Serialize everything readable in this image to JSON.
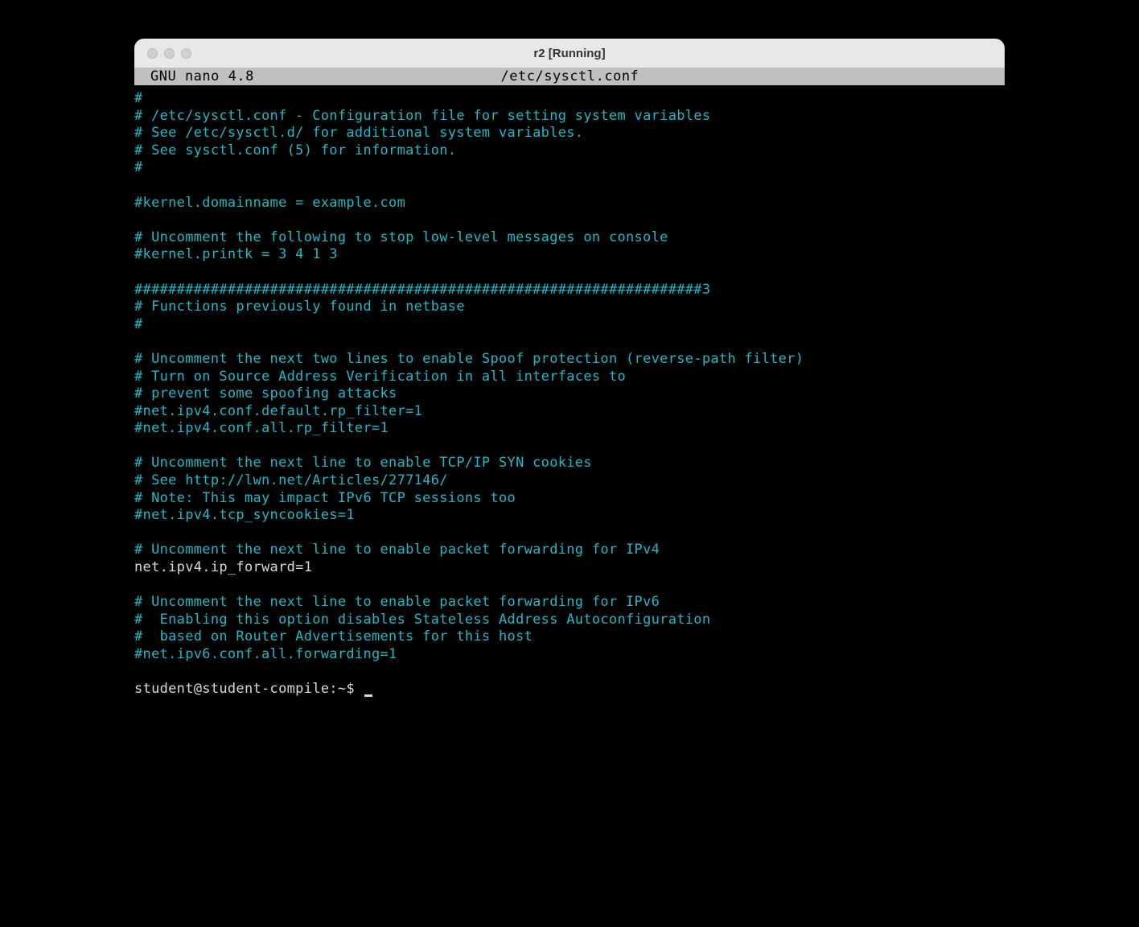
{
  "window": {
    "title": "r2 [Running]"
  },
  "nano": {
    "app": "  GNU nano 4.8",
    "file": "/etc/sysctl.conf"
  },
  "lines": [
    {
      "text": "#",
      "cls": "comment"
    },
    {
      "text": "# /etc/sysctl.conf - Configuration file for setting system variables",
      "cls": "comment"
    },
    {
      "text": "# See /etc/sysctl.d/ for additional system variables.",
      "cls": "comment"
    },
    {
      "text": "# See sysctl.conf (5) for information.",
      "cls": "comment"
    },
    {
      "text": "#",
      "cls": "comment"
    },
    {
      "text": "",
      "cls": "comment"
    },
    {
      "text": "#kernel.domainname = example.com",
      "cls": "comment"
    },
    {
      "text": "",
      "cls": "comment"
    },
    {
      "text": "# Uncomment the following to stop low-level messages on console",
      "cls": "comment"
    },
    {
      "text": "#kernel.printk = 3 4 1 3",
      "cls": "comment"
    },
    {
      "text": "",
      "cls": "comment"
    },
    {
      "text": "###################################################################3",
      "cls": "comment"
    },
    {
      "text": "# Functions previously found in netbase",
      "cls": "comment"
    },
    {
      "text": "#",
      "cls": "comment"
    },
    {
      "text": "",
      "cls": "comment"
    },
    {
      "text": "# Uncomment the next two lines to enable Spoof protection (reverse-path filter)",
      "cls": "comment"
    },
    {
      "text": "# Turn on Source Address Verification in all interfaces to",
      "cls": "comment"
    },
    {
      "text": "# prevent some spoofing attacks",
      "cls": "comment"
    },
    {
      "text": "#net.ipv4.conf.default.rp_filter=1",
      "cls": "comment"
    },
    {
      "text": "#net.ipv4.conf.all.rp_filter=1",
      "cls": "comment"
    },
    {
      "text": "",
      "cls": "comment"
    },
    {
      "text": "# Uncomment the next line to enable TCP/IP SYN cookies",
      "cls": "comment"
    },
    {
      "text": "# See http://lwn.net/Articles/277146/",
      "cls": "comment"
    },
    {
      "text": "# Note: This may impact IPv6 TCP sessions too",
      "cls": "comment"
    },
    {
      "text": "#net.ipv4.tcp_syncookies=1",
      "cls": "comment"
    },
    {
      "text": "",
      "cls": "comment"
    },
    {
      "text": "# Uncomment the next line to enable packet forwarding for IPv4",
      "cls": "comment"
    },
    {
      "text": "net.ipv4.ip_forward=1",
      "cls": "active-line"
    },
    {
      "text": "",
      "cls": "comment"
    },
    {
      "text": "# Uncomment the next line to enable packet forwarding for IPv6",
      "cls": "comment"
    },
    {
      "text": "#  Enabling this option disables Stateless Address Autoconfiguration",
      "cls": "comment"
    },
    {
      "text": "#  based on Router Advertisements for this host",
      "cls": "comment"
    },
    {
      "text": "#net.ipv6.conf.all.forwarding=1",
      "cls": "comment"
    }
  ],
  "prompt": "student@student-compile:~$ "
}
